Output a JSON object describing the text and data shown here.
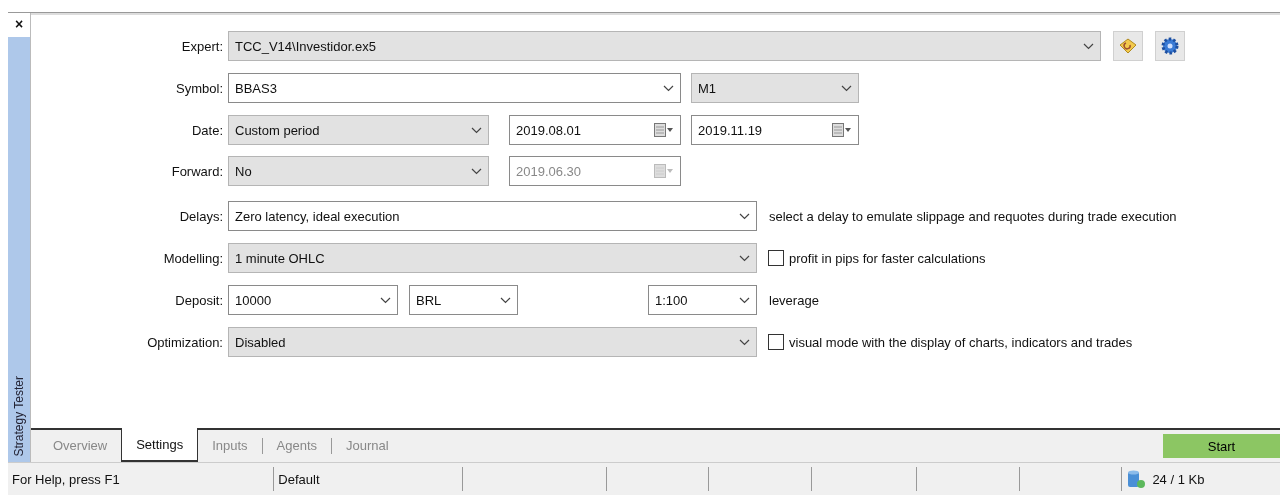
{
  "panel": {
    "title": "Strategy Tester",
    "close": "×"
  },
  "sections": [
    [
      {
        "label": "Expert:",
        "fields": [
          {
            "kind": "dropdown",
            "value": "TCC_V14\\Investidor.ex5",
            "editable": false
          }
        ],
        "tools": [
          {
            "kind": "edit"
          },
          {
            "kind": "settings"
          }
        ]
      },
      {
        "label": "Symbol:",
        "fields": [
          {
            "kind": "dropdown",
            "value": "BBAS3",
            "editable": true
          },
          {
            "kind": "dropdown",
            "value": "M1",
            "editable": false
          }
        ]
      },
      {
        "label": "Date:",
        "fields": [
          {
            "kind": "dropdown",
            "value": "Custom period",
            "editable": false
          },
          {
            "kind": "date",
            "value": "2019.08.01",
            "disabled": false
          },
          {
            "kind": "date",
            "value": "2019.11.19",
            "disabled": false
          }
        ]
      }
    ],
    [
      {
        "label": "Forward:",
        "fields": [
          {
            "kind": "dropdown",
            "value": "No",
            "editable": false
          },
          {
            "kind": "date",
            "value": "2019.06.30",
            "disabled": true
          }
        ]
      }
    ],
    [
      {
        "label": "Delays:",
        "fields": [
          {
            "kind": "dropdown",
            "value": "Zero latency, ideal execution",
            "editable": true
          }
        ],
        "note": "select a delay to emulate slippage and requotes during trade execution"
      },
      {
        "label": "Modelling:",
        "fields": [
          {
            "kind": "dropdown",
            "value": "1 minute OHLC",
            "editable": false
          }
        ],
        "checkbox": {
          "label": "profit in pips for faster calculations",
          "checked": false
        }
      },
      {
        "label": "Deposit:",
        "fields": [
          {
            "kind": "dropdown",
            "value": "10000",
            "editable": true
          },
          {
            "kind": "dropdown",
            "value": "BRL",
            "editable": true
          },
          {
            "kind": "dropdown",
            "value": "1:100",
            "editable": true
          }
        ],
        "note": "leverage"
      }
    ],
    [
      {
        "label": "Optimization:",
        "fields": [
          {
            "kind": "dropdown",
            "value": "Disabled",
            "editable": false
          }
        ],
        "checkbox": {
          "label": "visual mode with the display of charts, indicators and trades",
          "checked": false
        }
      }
    ]
  ],
  "tabs": [
    {
      "label": "Overview",
      "selected": false
    },
    {
      "label": "Settings",
      "selected": true
    },
    {
      "label": "Inputs",
      "selected": false
    },
    {
      "label": "Agents",
      "selected": false
    },
    {
      "label": "Journal",
      "selected": false
    }
  ],
  "start_button": "Start",
  "status_bar": {
    "help": "For Help, press F1",
    "profile": "Default",
    "traffic": "24 / 1 Kb"
  }
}
